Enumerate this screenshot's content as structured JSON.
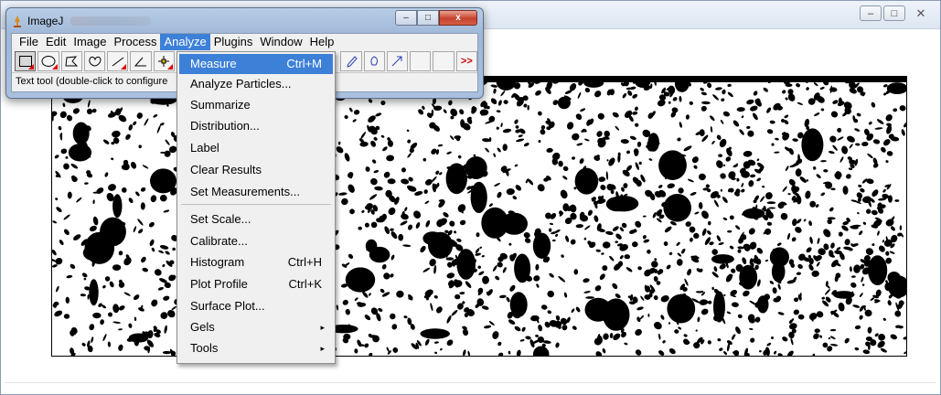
{
  "imagej": {
    "title": "ImageJ",
    "menu": [
      "File",
      "Edit",
      "Image",
      "Process",
      "Analyze",
      "Plugins",
      "Window",
      "Help"
    ],
    "active_menu": "Analyze",
    "status": "Text tool (double-click to configure",
    "more_tools": ">>",
    "controls": {
      "minimize": "–",
      "maximize": "□",
      "close": "x"
    }
  },
  "background_window": {
    "controls": {
      "minimize": "–",
      "maximize": "□",
      "close": "✕"
    }
  },
  "analyze_menu": {
    "items": [
      {
        "label": "Measure",
        "shortcut": "Ctrl+M"
      },
      {
        "label": "Analyze Particles...",
        "shortcut": ""
      },
      {
        "label": "Summarize",
        "shortcut": ""
      },
      {
        "label": "Distribution...",
        "shortcut": ""
      },
      {
        "label": "Label",
        "shortcut": ""
      },
      {
        "label": "Clear Results",
        "shortcut": ""
      },
      {
        "label": "Set Measurements...",
        "shortcut": ""
      },
      {
        "label": "Set Scale...",
        "shortcut": ""
      },
      {
        "label": "Calibrate...",
        "shortcut": ""
      },
      {
        "label": "Histogram",
        "shortcut": "Ctrl+H"
      },
      {
        "label": "Plot Profile",
        "shortcut": "Ctrl+K"
      },
      {
        "label": "Surface Plot...",
        "shortcut": ""
      },
      {
        "label": "Gels",
        "submenu": "▸"
      },
      {
        "label": "Tools",
        "submenu": "▸"
      }
    ]
  },
  "colors": {
    "highlight": "#3d80d8",
    "menu_bg": "#f0f0f0",
    "close_red": "#c6432d"
  }
}
